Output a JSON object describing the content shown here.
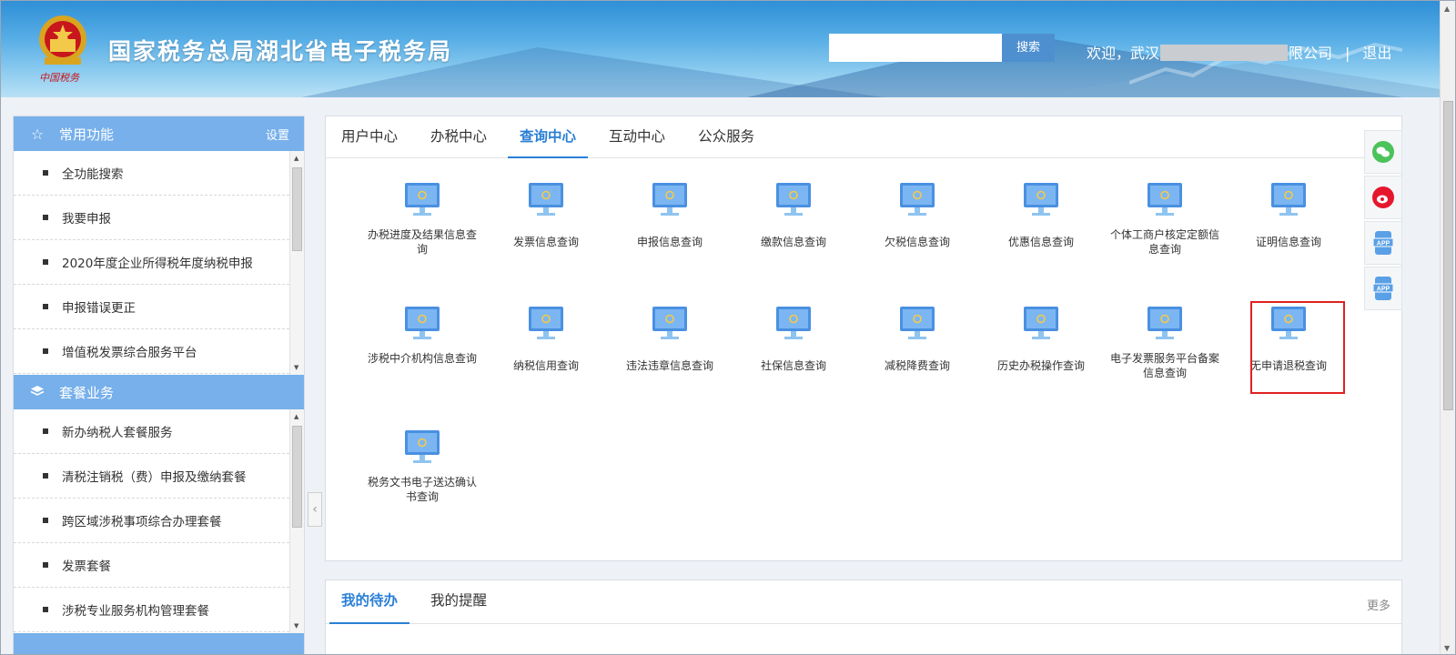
{
  "header": {
    "site_title": "国家税务总局湖北省电子税务局",
    "emblem_text": "中国税务",
    "search_placeholder": "",
    "search_label": "搜索",
    "welcome_prefix": "欢迎，武汉",
    "welcome_suffix": "限公司",
    "separator": "|",
    "logout_label": "退出"
  },
  "sidebar": {
    "common": {
      "title": "常用功能",
      "setting_label": "设置",
      "items": [
        {
          "label": "全功能搜索"
        },
        {
          "label": "我要申报"
        },
        {
          "label": "2020年度企业所得税年度纳税申报"
        },
        {
          "label": "申报错误更正"
        },
        {
          "label": "增值税发票综合服务平台"
        }
      ]
    },
    "packages": {
      "title": "套餐业务",
      "items": [
        {
          "label": "新办纳税人套餐服务"
        },
        {
          "label": "清税注销税（费）申报及缴纳套餐"
        },
        {
          "label": "跨区域涉税事项综合办理套餐"
        },
        {
          "label": "发票套餐"
        },
        {
          "label": "涉税专业服务机构管理套餐"
        }
      ]
    }
  },
  "main": {
    "tabs": [
      {
        "label": "用户中心",
        "active": false
      },
      {
        "label": "办税中心",
        "active": false
      },
      {
        "label": "查询中心",
        "active": true
      },
      {
        "label": "互动中心",
        "active": false
      },
      {
        "label": "公众服务",
        "active": false
      }
    ],
    "items": [
      {
        "label": "办税进度及结果信息查询"
      },
      {
        "label": "发票信息查询"
      },
      {
        "label": "申报信息查询"
      },
      {
        "label": "缴款信息查询"
      },
      {
        "label": "欠税信息查询"
      },
      {
        "label": "优惠信息查询"
      },
      {
        "label": "个体工商户核定定额信息查询"
      },
      {
        "label": "证明信息查询"
      },
      {
        "label": "涉税中介机构信息查询"
      },
      {
        "label": "纳税信用查询"
      },
      {
        "label": "违法违章信息查询"
      },
      {
        "label": "社保信息查询"
      },
      {
        "label": "减税降费查询"
      },
      {
        "label": "历史办税操作查询"
      },
      {
        "label": "电子发票服务平台备案信息查询"
      },
      {
        "label": "无申请退税查询",
        "highlighted": true
      },
      {
        "label": "税务文书电子送达确认书查询"
      }
    ]
  },
  "todo": {
    "tabs": [
      {
        "label": "我的待办",
        "active": true
      },
      {
        "label": "我的提醒",
        "active": false
      }
    ],
    "more_label": "更多"
  },
  "social": {
    "icons": [
      "wechat-icon",
      "weibo-icon",
      "app-icon",
      "app-icon"
    ],
    "app_text": "APP"
  },
  "colors": {
    "accent": "#2a7fd5",
    "panel_header": "#77b0ea",
    "highlight": "#e02020",
    "monitor": "#4a90e2",
    "monitor_stand": "#8fc4f0"
  }
}
